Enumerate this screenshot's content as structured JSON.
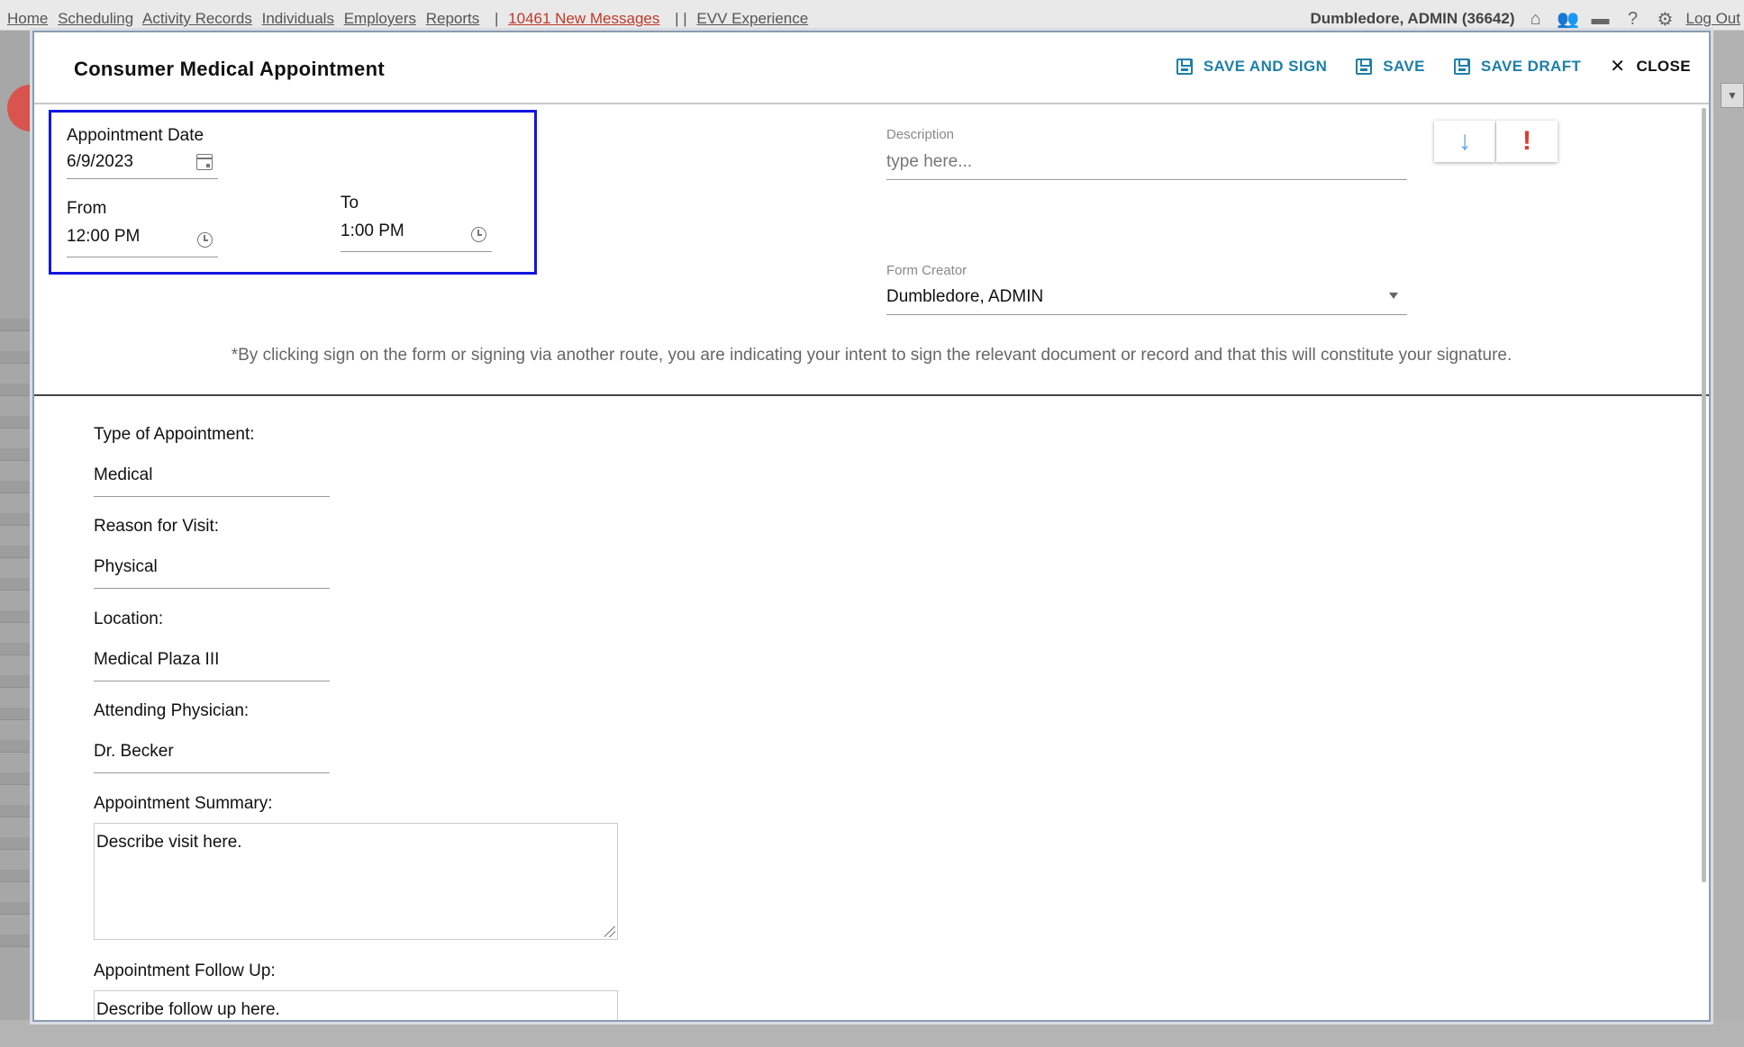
{
  "topnav": {
    "links": [
      "Home",
      "Scheduling",
      "Activity Records",
      "Individuals",
      "Employers",
      "Reports"
    ],
    "messages": "10461 New Messages",
    "evv": "EVV Experience",
    "user": "Dumbledore, ADMIN",
    "user_id": "(36642)",
    "logout": "Log Out"
  },
  "modal": {
    "title": "Consumer Medical Appointment",
    "actions": {
      "save_and_sign": "SAVE AND SIGN",
      "save": "SAVE",
      "save_draft": "SAVE DRAFT",
      "close": "CLOSE"
    },
    "appointment": {
      "date_label": "Appointment Date",
      "date_value": "6/9/2023",
      "from_label": "From",
      "from_value": "12:00 PM",
      "to_label": "To",
      "to_value": "1:00 PM"
    },
    "description": {
      "label": "Description",
      "placeholder": "type here..."
    },
    "form_creator": {
      "label": "Form Creator",
      "value": "Dumbledore, ADMIN"
    },
    "priority": {
      "low_symbol": "↓",
      "high_symbol": "!"
    },
    "disclaimer": "*By clicking sign on the form or signing via another route, you are indicating your intent to sign the relevant document or record and that this will constitute your signature.",
    "fields": {
      "type_label": "Type of Appointment:",
      "type_value": "Medical",
      "reason_label": "Reason for Visit:",
      "reason_value": "Physical",
      "location_label": "Location:",
      "location_value": "Medical Plaza III",
      "physician_label": "Attending Physician:",
      "physician_value": "Dr. Becker",
      "summary_label": "Appointment Summary:",
      "summary_value": "Describe visit here.",
      "followup_label": "Appointment Follow Up:",
      "followup_value": "Describe follow up here."
    }
  }
}
